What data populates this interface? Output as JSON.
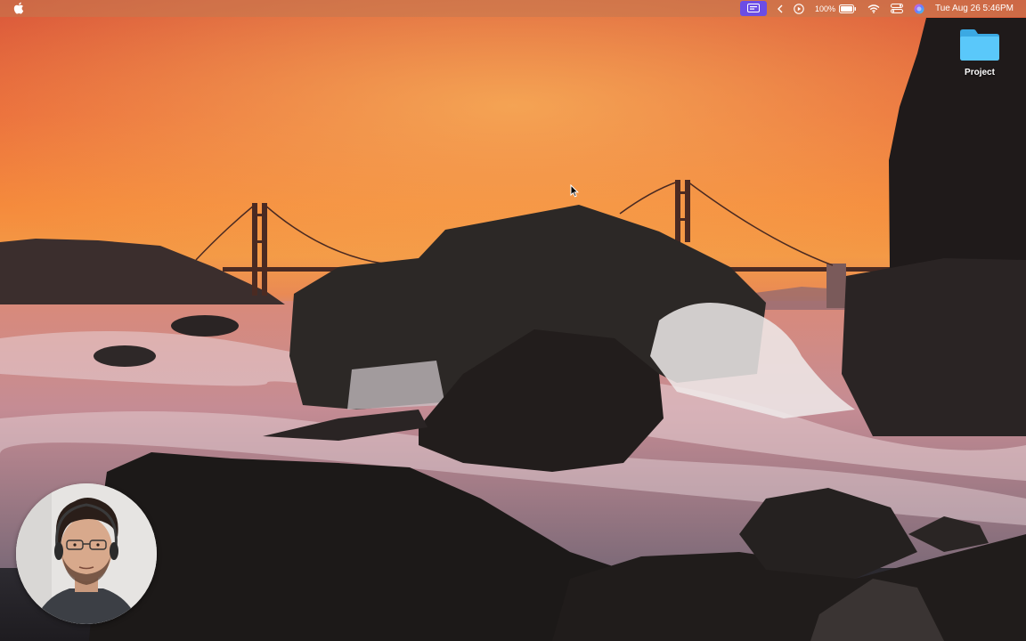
{
  "menubar": {
    "battery_percent": "100%",
    "datetime": "Tue Aug 26  5:46PM",
    "icons": [
      "apple-logo",
      "screen-record-icon",
      "chevron-left-icon",
      "play-circle-icon",
      "battery-icon",
      "wifi-icon",
      "control-center-icon",
      "siri-icon"
    ]
  },
  "desktop": {
    "items": [
      {
        "label": "Project",
        "icon": "folder-icon",
        "color": "#5ac8fa"
      }
    ]
  },
  "overlay": {
    "webcam": "presenter-webcam"
  }
}
